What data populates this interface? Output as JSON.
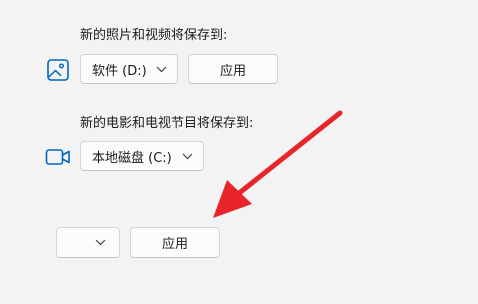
{
  "photos_section": {
    "label": "新的照片和视频将保存到:",
    "icon": "image-icon",
    "drive_value": "软件 (D:)",
    "apply_label": "应用"
  },
  "tv_section": {
    "label": "新的电影和电视节目将保存到:",
    "icon": "video-camera-icon",
    "drive_value": "本地磁盘 (C:)"
  },
  "bottom_row": {
    "drive_value": "",
    "apply_label": "应用"
  },
  "annotation": {
    "icon": "red-pointer-arrow",
    "color": "#e8252a"
  },
  "colors": {
    "accent": "#0067c0",
    "background": "#f3f3f3"
  }
}
